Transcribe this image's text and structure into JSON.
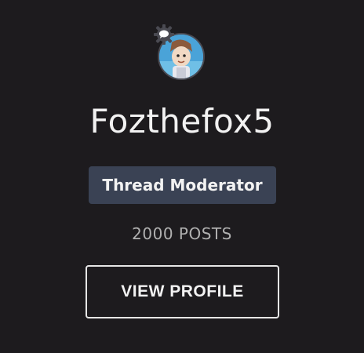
{
  "profile": {
    "username": "Fozthefox5",
    "role": "Thread Moderator",
    "posts": "2000 POSTS",
    "view_profile_label": "VIEW PROFILE",
    "avatar_icon": "user-avatar",
    "status_icon": "chat-bubble-gear-icon"
  },
  "colors": {
    "background": "#1d1b1e",
    "role_badge": "#3a4254",
    "text": "#f2f2f2",
    "muted_text": "#b0b0b0",
    "button_border": "#e6e6e6"
  }
}
